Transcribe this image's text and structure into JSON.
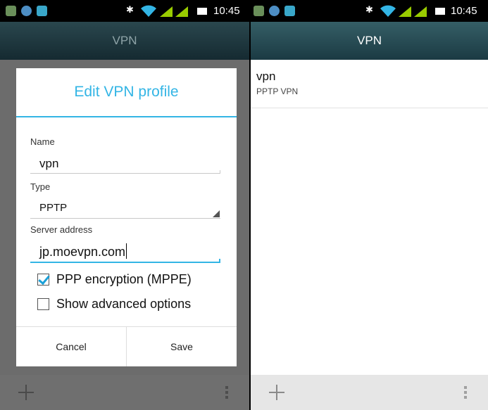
{
  "colors": {
    "accent": "#33b5e5",
    "checkbox_check": "#1aa0d8",
    "actionbar_active": "#2a5058",
    "scrim": "#6c6c6c",
    "status_signal": "#99cc00",
    "status_wifi": "#33b5e5"
  },
  "left_screen": {
    "status_bar": {
      "time": "10:45",
      "icons": [
        "gallery-icon",
        "usb-debug-icon",
        "android-icon",
        "bluetooth-icon",
        "wifi-icon",
        "signal-icon",
        "signal-icon",
        "battery-icon"
      ]
    },
    "action_bar": {
      "title": "VPN"
    },
    "dialog": {
      "title": "Edit VPN profile",
      "name_label": "Name",
      "name_value": "vpn",
      "type_label": "Type",
      "type_value": "PPTP",
      "server_label": "Server address",
      "server_value": "jp.moevpn.com",
      "ppp_encryption_label": "PPP encryption (MPPE)",
      "ppp_encryption_checked": true,
      "show_advanced_label": "Show advanced options",
      "show_advanced_checked": false,
      "cancel_label": "Cancel",
      "save_label": "Save"
    },
    "bottom_bar": {
      "icons": [
        "plus-icon",
        "overflow-menu-icon"
      ]
    }
  },
  "right_screen": {
    "status_bar": {
      "time": "10:45",
      "icons": [
        "gallery-icon",
        "usb-debug-icon",
        "android-icon",
        "bluetooth-icon",
        "wifi-icon",
        "signal-icon",
        "signal-icon",
        "battery-icon"
      ]
    },
    "action_bar": {
      "title": "VPN"
    },
    "vpn_list": [
      {
        "name": "vpn",
        "type": "PPTP VPN"
      }
    ],
    "bottom_bar": {
      "icons": [
        "plus-icon",
        "overflow-menu-icon"
      ]
    }
  }
}
